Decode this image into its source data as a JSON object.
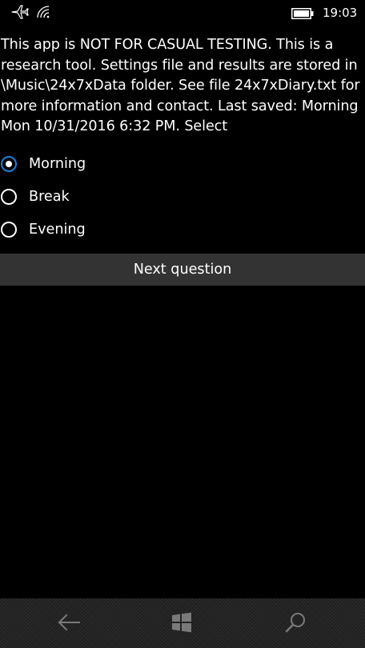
{
  "status_bar": {
    "icons": [
      "airplane-icon",
      "wifi-icon",
      "battery-icon"
    ],
    "time": "19:03"
  },
  "intro_text": "This app is NOT FOR CASUAL TESTING. This is a research tool. Settings file and results are stored in \\Music\\24x7xData folder. See file 24x7xDiary.txt for more information and contact. Last saved: Morning Mon 10/31/2016 6:32 PM. Select",
  "options": [
    {
      "label": "Morning",
      "selected": true
    },
    {
      "label": "Break",
      "selected": false
    },
    {
      "label": "Evening",
      "selected": false
    }
  ],
  "next_button_label": "Next question",
  "nav_bar": {
    "icons": [
      "back-arrow-icon",
      "windows-logo-icon",
      "search-icon"
    ]
  },
  "colors": {
    "background": "#000000",
    "accent": "#1e7ed8",
    "button_background": "#333333",
    "nav_background": "#1f1f1f",
    "text": "#ffffff",
    "nav_icon": "#7a7a7a"
  }
}
